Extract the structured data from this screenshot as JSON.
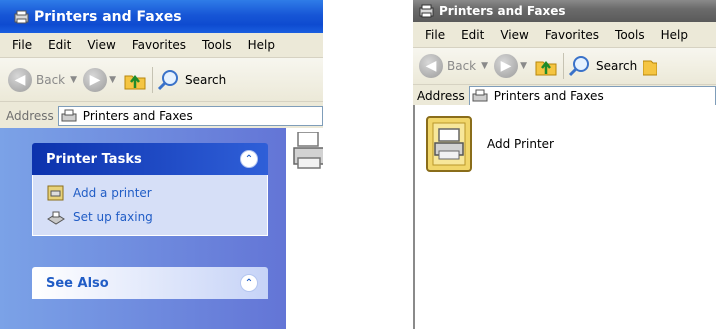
{
  "left_window": {
    "title": "Printers and Faxes",
    "menu": [
      "File",
      "Edit",
      "View",
      "Favorites",
      "Tools",
      "Help"
    ],
    "menu_mnemonic_index": [
      0,
      0,
      0,
      1,
      0,
      0
    ],
    "toolbar": {
      "back_label": "Back",
      "search_label": "Search"
    },
    "address": {
      "label": "Address",
      "value": "Printers and Faxes"
    },
    "task_pane": {
      "printer_tasks": {
        "title": "Printer Tasks",
        "items": [
          {
            "label": "Add a printer",
            "icon": "add-printer-icon"
          },
          {
            "label": "Set up faxing",
            "icon": "fax-icon"
          }
        ]
      },
      "see_also": {
        "title": "See Also"
      }
    }
  },
  "right_window": {
    "title": "Printers and Faxes",
    "menu": [
      "File",
      "Edit",
      "View",
      "Favorites",
      "Tools",
      "Help"
    ],
    "toolbar": {
      "back_label": "Back",
      "search_label": "Search"
    },
    "address": {
      "label": "Address",
      "value": "Printers and Faxes"
    },
    "items": [
      {
        "label": "Add Printer",
        "icon": "add-printer-wizard-icon"
      }
    ]
  },
  "colors": {
    "xp_blue_title": "#0e4bd0",
    "classic_gray_title": "#6b6b6b",
    "task_pane_blue": "#6375d6",
    "link_blue": "#215dc6"
  }
}
